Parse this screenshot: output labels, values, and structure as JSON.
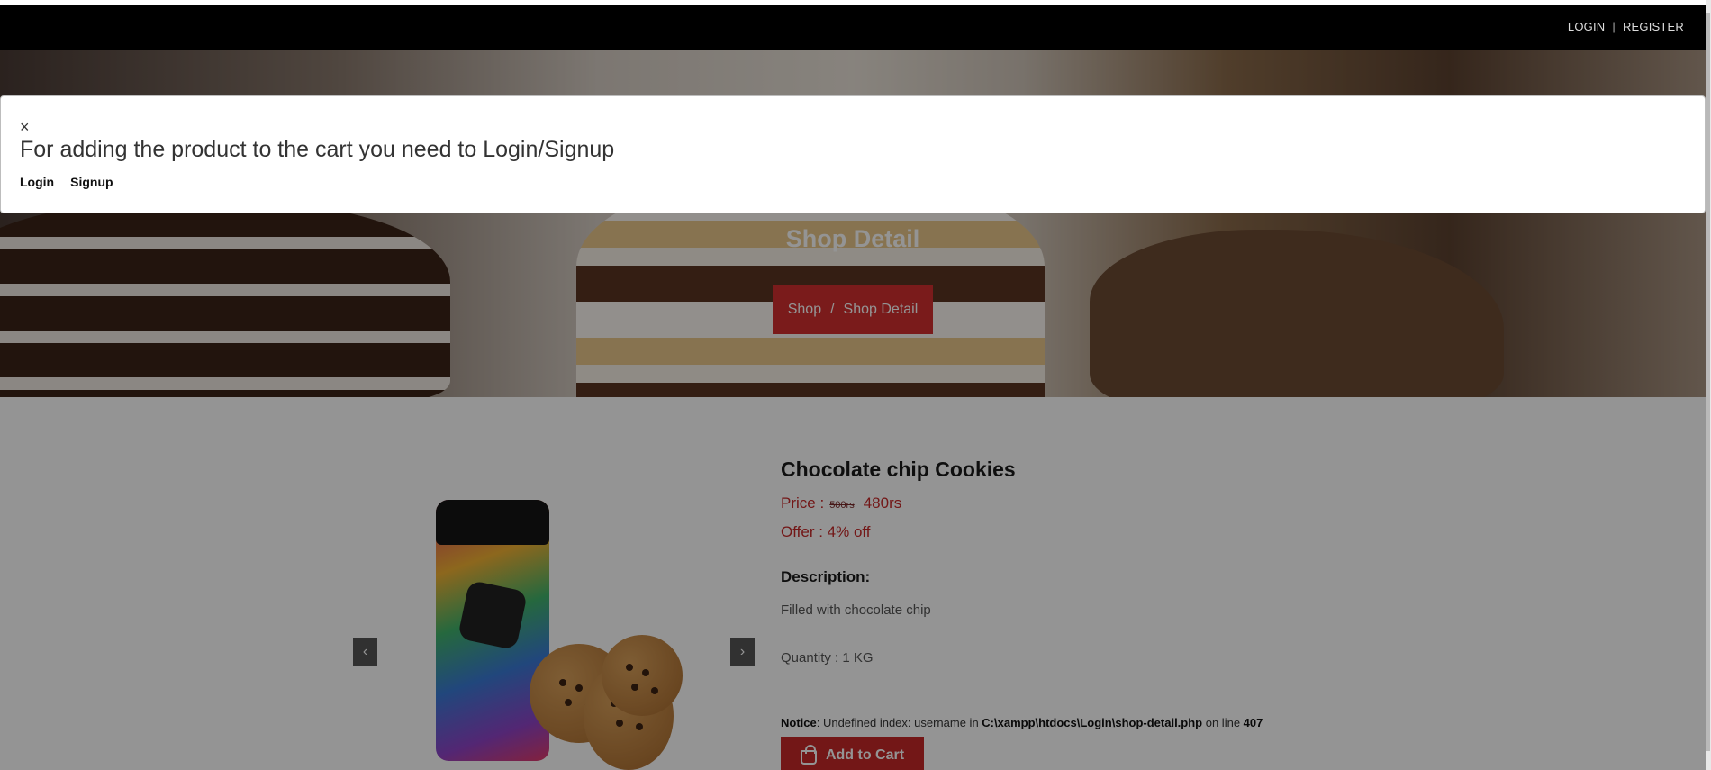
{
  "topbar": {
    "login": "LOGIN",
    "separator": "|",
    "register": "REGISTER"
  },
  "hero": {
    "title": "Shop Detail",
    "breadcrumb": {
      "home": "Shop",
      "sep": "/",
      "current": "Shop Detail"
    }
  },
  "modal": {
    "close": "×",
    "message": "For adding the product to the cart you need to Login/Signup",
    "login": "Login",
    "signup": "Signup"
  },
  "product": {
    "title": "Chocolate chip Cookies",
    "price_label": "Price :",
    "old_price": "500rs",
    "new_price": "480rs",
    "offer": "Offer : 4% off",
    "description_heading": "Description:",
    "description": "Filled with chocolate chip",
    "quantity": "Quantity : 1 KG",
    "add_to_cart": "Add to Cart"
  },
  "carousel": {
    "prev_icon": "‹",
    "next_icon": "›"
  },
  "notice": {
    "label": "Notice",
    "text": ": Undefined index: username in ",
    "path": "C:\\xampp\\htdocs\\Login\\shop-detail.php",
    "on_line": " on line ",
    "line": "407"
  },
  "colors": {
    "accent": "#c62828",
    "topbar": "#000000"
  }
}
